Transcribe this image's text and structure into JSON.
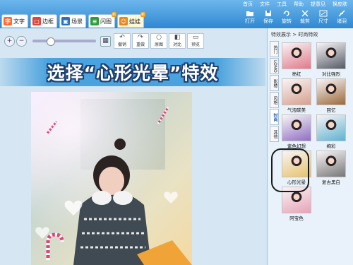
{
  "top_menu": [
    "首页",
    "文件",
    "工具",
    "帮助",
    "提意见",
    "换皮肤"
  ],
  "toolbar": [
    {
      "label": "打开",
      "icon": "open-folder-icon"
    },
    {
      "label": "保存",
      "icon": "save-icon"
    },
    {
      "label": "旋转",
      "icon": "rotate-icon"
    },
    {
      "label": "裁剪",
      "icon": "crop-icon"
    },
    {
      "label": "尺寸",
      "icon": "resize-icon"
    },
    {
      "label": "诸羽",
      "icon": "feather-icon"
    }
  ],
  "tabs": [
    {
      "label": "文字",
      "glyph": "字",
      "color": "#ff6a2b"
    },
    {
      "label": "边框",
      "glyph": "□",
      "color": "#e0443a"
    },
    {
      "label": "场景",
      "glyph": "▣",
      "color": "#2d6fb8"
    },
    {
      "label": "闪图",
      "glyph": "≡",
      "color": "#2d9c3c",
      "badge": "新"
    },
    {
      "label": "娃娃",
      "glyph": "☺",
      "color": "#e88520",
      "badge": "新"
    }
  ],
  "edit_tools": [
    {
      "label": "撤销",
      "glyph": "↶"
    },
    {
      "label": "重做",
      "glyph": "↷"
    },
    {
      "label": "原图",
      "glyph": "○"
    },
    {
      "label": "对比",
      "glyph": "◧"
    },
    {
      "label": "预览",
      "glyph": "▭"
    }
  ],
  "zoom": {
    "in": "+",
    "out": "−",
    "fit": "▦"
  },
  "banner": "选择“心形光晕”特效",
  "breadcrumb": "特效展示 > 时尚特效",
  "side_tabs": [
    {
      "label": "热门",
      "active": false
    },
    {
      "label": "LOMO",
      "active": false
    },
    {
      "label": "影楼",
      "active": false
    },
    {
      "label": "风格",
      "active": false
    },
    {
      "label": "时尚",
      "active": true
    },
    {
      "label": "其他",
      "active": false
    }
  ],
  "effects": [
    {
      "label": "亮红",
      "tint": "#e07a8a"
    },
    {
      "label": "对比强烈",
      "tint": "#555a66"
    },
    {
      "label": "气泡碳美",
      "tint": "#d7a08e"
    },
    {
      "label": "回忆",
      "tint": "#9a6a3a"
    },
    {
      "label": "紫色幻想",
      "tint": "#8e6fc2"
    },
    {
      "label": "绚彩",
      "tint": "#5fb2d0"
    },
    {
      "label": "心形光晕",
      "tint": "#e6c36b",
      "selected": true
    },
    {
      "label": "复古黑白",
      "tint": "#777777"
    },
    {
      "label": "阿宝色",
      "tint": "#e6a3b6"
    }
  ]
}
